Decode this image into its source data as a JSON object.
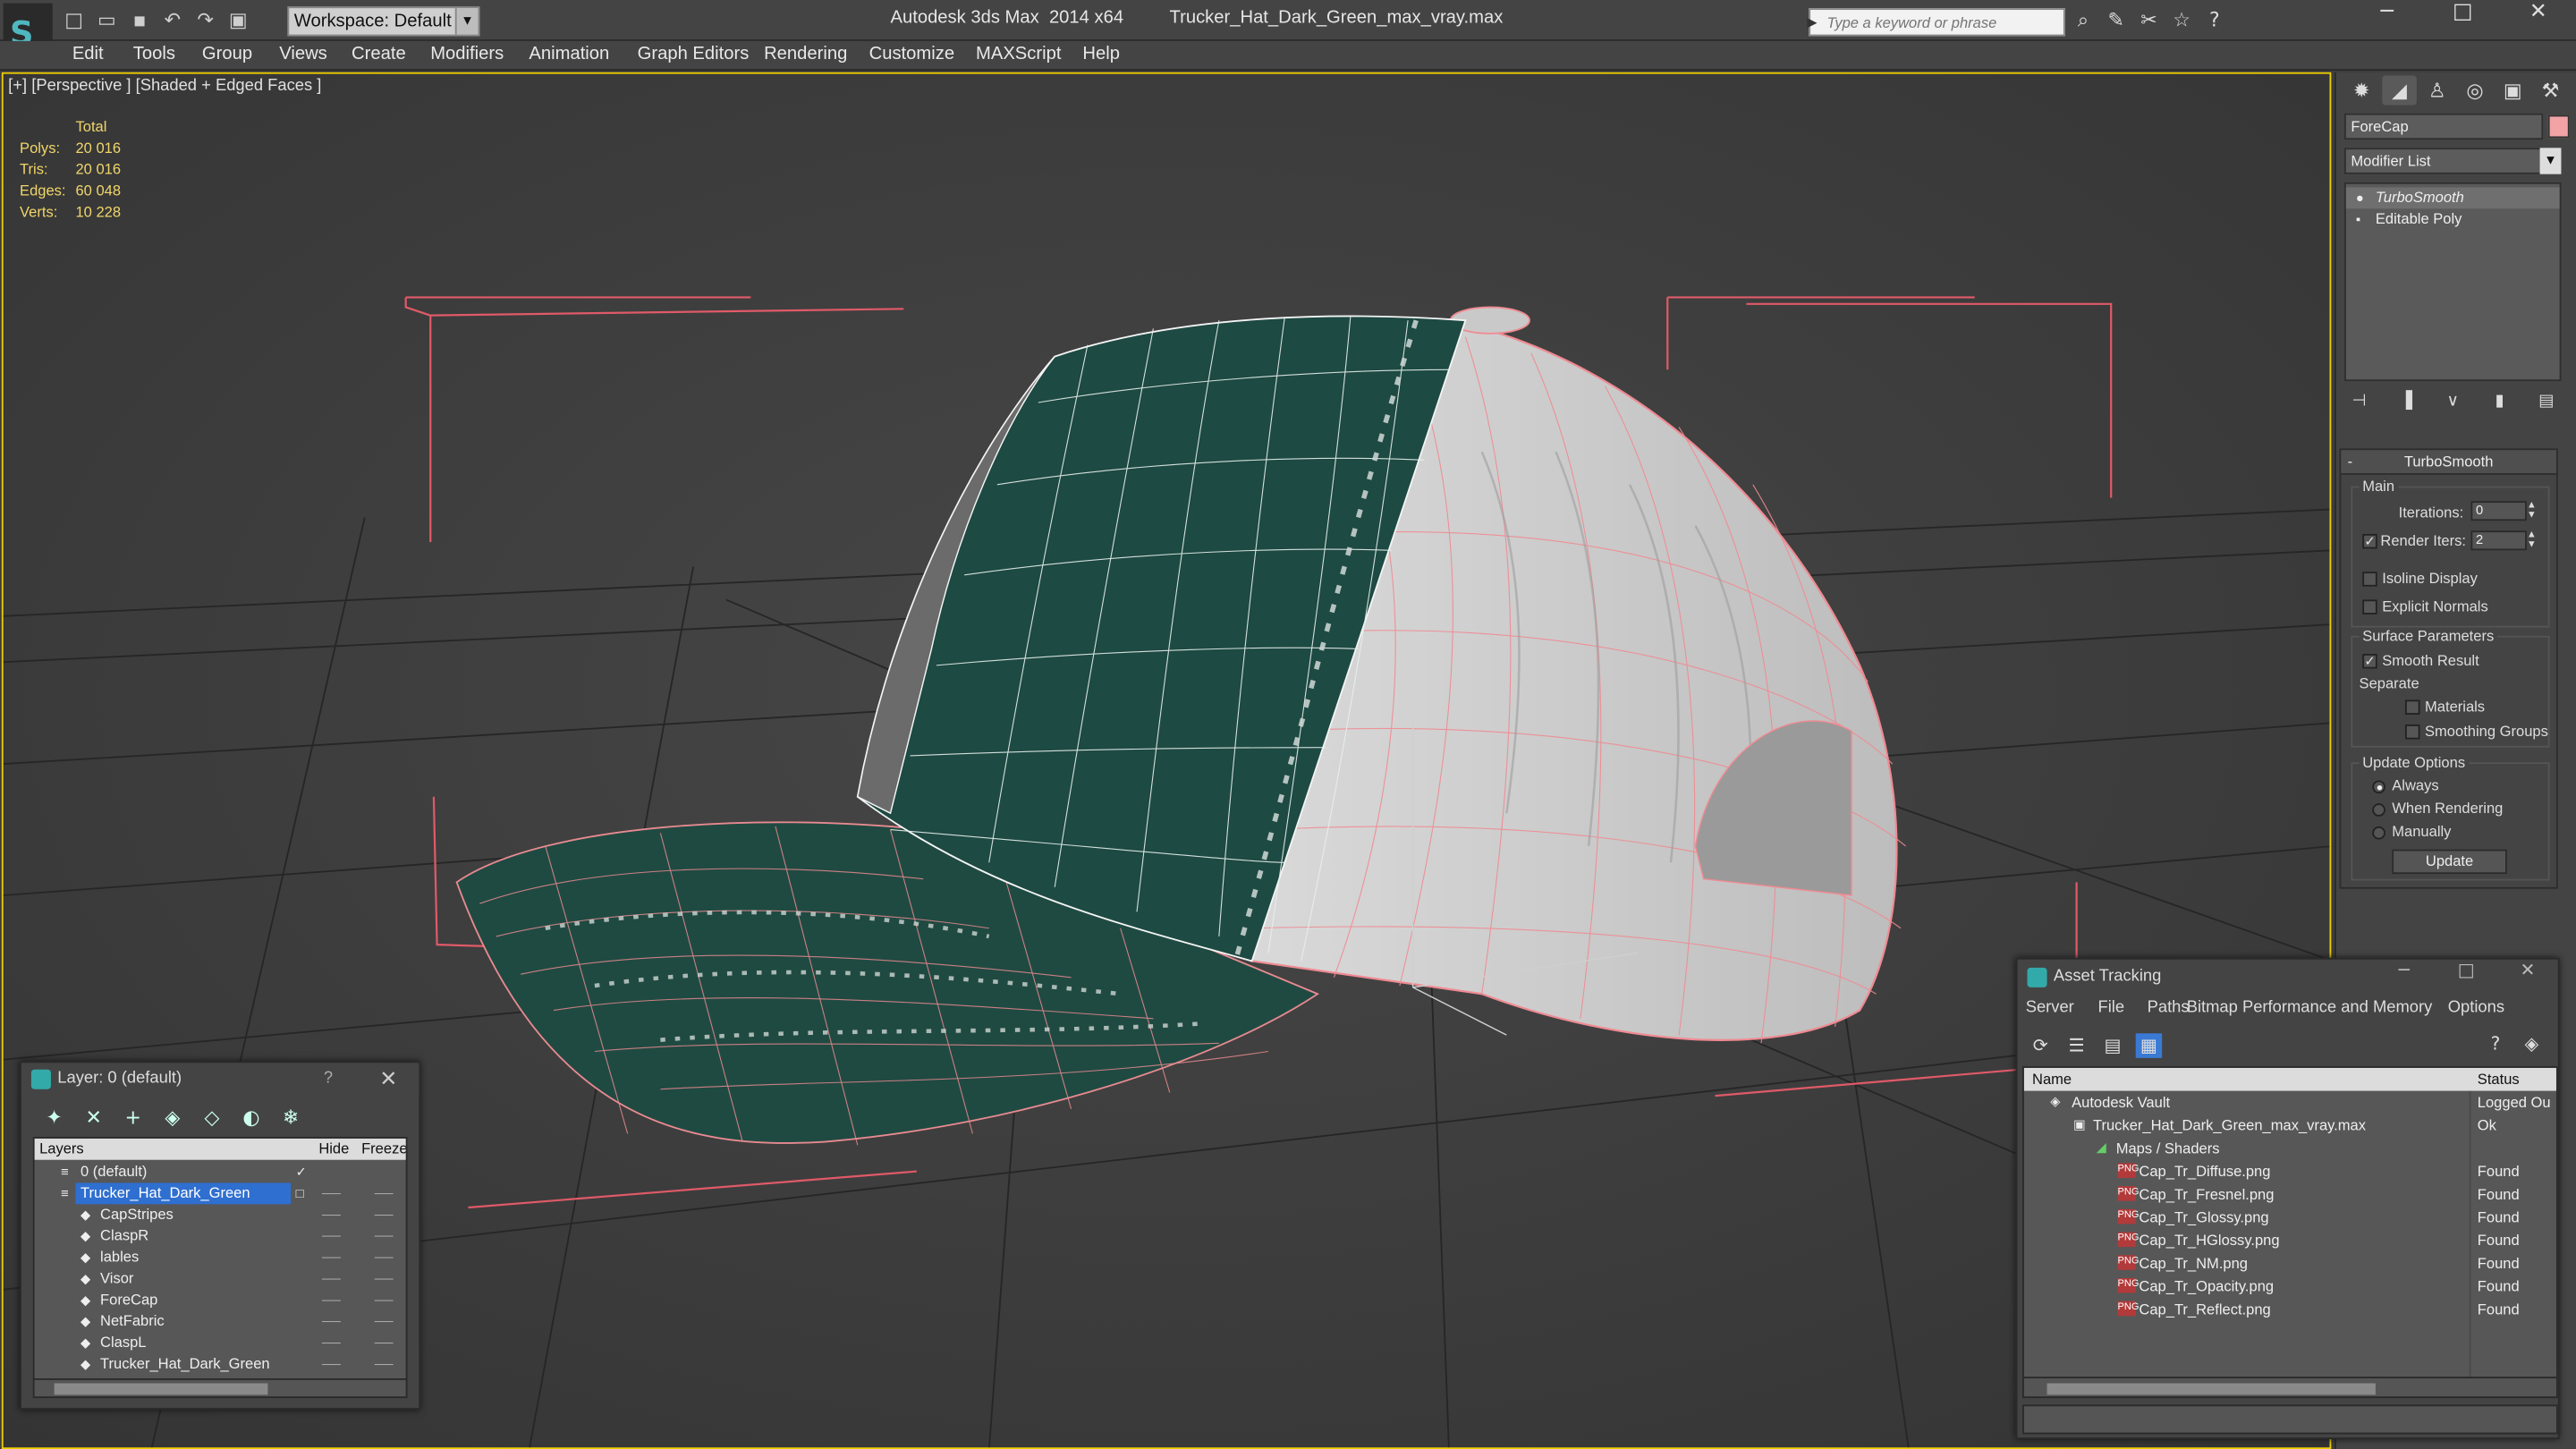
{
  "app": {
    "title": "Autodesk 3ds Max  2014 x64",
    "file": "Trucker_Hat_Dark_Green_max_vray.max",
    "workspace": "Workspace: Default",
    "search_placeholder": "Type a keyword or phrase"
  },
  "menu": [
    "Edit",
    "Tools",
    "Group",
    "Views",
    "Create",
    "Modifiers",
    "Animation",
    "Graph Editors",
    "Rendering",
    "Customize",
    "MAXScript",
    "Help"
  ],
  "viewport": {
    "label": "[+] [Perspective ] [Shaded + Edged Faces ]",
    "stats": {
      "header": "Total",
      "rows": [
        {
          "k": "Polys:",
          "v": "20 016"
        },
        {
          "k": "Tris:",
          "v": "20 016"
        },
        {
          "k": "Edges:",
          "v": "60 048"
        },
        {
          "k": "Verts:",
          "v": "10 228"
        }
      ]
    }
  },
  "command_panel": {
    "object_name": "ForeCap",
    "object_color": "#f1a3a6",
    "modifier_list": "Modifier List",
    "stack": [
      "TurboSmooth",
      "Editable Poly"
    ],
    "rollout_title": "TurboSmooth",
    "main_group": "Main",
    "iterations_label": "Iterations:",
    "iterations_value": "0",
    "render_iters_label": "Render Iters:",
    "render_iters_value": "2",
    "isoline": "Isoline Display",
    "explicit": "Explicit Normals",
    "surface_group": "Surface Parameters",
    "smooth_result": "Smooth Result",
    "separate": "Separate",
    "materials": "Materials",
    "smoothing_groups": "Smoothing Groups",
    "update_group": "Update Options",
    "always": "Always",
    "when_rendering": "When Rendering",
    "manually": "Manually",
    "update_button": "Update"
  },
  "layer_window": {
    "title": "Layer: 0 (default)",
    "help": "?",
    "col_layers": "Layers",
    "col_hide": "Hide",
    "col_freeze": "Freeze",
    "rows": [
      {
        "name": "0 (default)",
        "level": 0,
        "selected": false
      },
      {
        "name": "Trucker_Hat_Dark_Green",
        "level": 0,
        "selected": true
      },
      {
        "name": "CapStripes",
        "level": 1,
        "selected": false
      },
      {
        "name": "ClaspR",
        "level": 1,
        "selected": false
      },
      {
        "name": "lables",
        "level": 1,
        "selected": false
      },
      {
        "name": "Visor",
        "level": 1,
        "selected": false
      },
      {
        "name": "ForeCap",
        "level": 1,
        "selected": false
      },
      {
        "name": "NetFabric",
        "level": 1,
        "selected": false
      },
      {
        "name": "ClaspL",
        "level": 1,
        "selected": false
      },
      {
        "name": "Trucker_Hat_Dark_Green",
        "level": 1,
        "selected": false
      }
    ]
  },
  "asset_tracking": {
    "title": "Asset Tracking",
    "menu": [
      "Server",
      "File",
      "Paths",
      "Bitmap Performance and Memory",
      "Options"
    ],
    "col_name": "Name",
    "col_status": "Status",
    "rows": [
      {
        "name": "Autodesk Vault",
        "status": "Logged Ou",
        "level": 0
      },
      {
        "name": "Trucker_Hat_Dark_Green_max_vray.max",
        "status": "Ok",
        "level": 1
      },
      {
        "name": "Maps / Shaders",
        "status": "",
        "level": 2
      },
      {
        "name": "Cap_Tr_Diffuse.png",
        "status": "Found",
        "level": 3
      },
      {
        "name": "Cap_Tr_Fresnel.png",
        "status": "Found",
        "level": 3
      },
      {
        "name": "Cap_Tr_Glossy.png",
        "status": "Found",
        "level": 3
      },
      {
        "name": "Cap_Tr_HGlossy.png",
        "status": "Found",
        "level": 3
      },
      {
        "name": "Cap_Tr_NM.png",
        "status": "Found",
        "level": 3
      },
      {
        "name": "Cap_Tr_Opacity.png",
        "status": "Found",
        "level": 3
      },
      {
        "name": "Cap_Tr_Reflect.png",
        "status": "Found",
        "level": 3
      }
    ]
  }
}
